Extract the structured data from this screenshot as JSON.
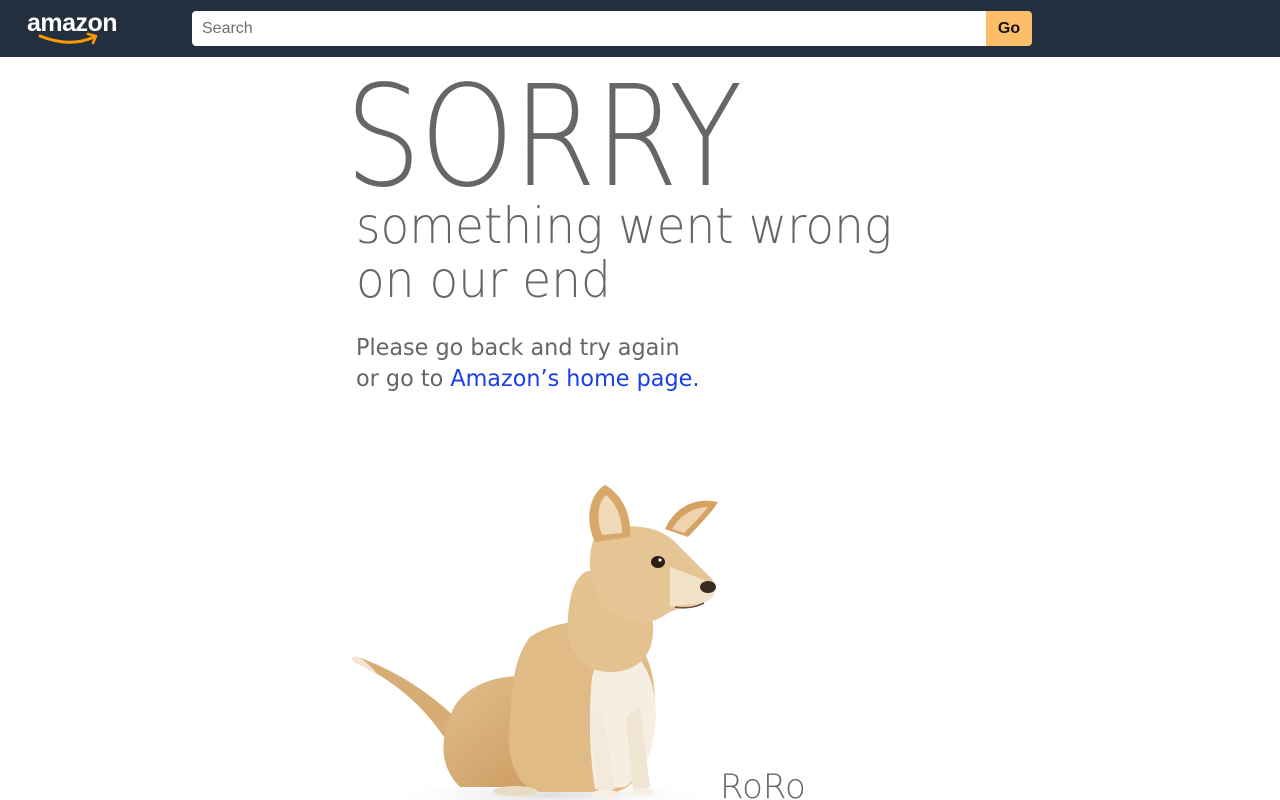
{
  "header": {
    "logo_text": "amazon",
    "logo_icon": "amazon-smile-logo",
    "bg_color": "#232f3e",
    "search": {
      "placeholder": "Search",
      "value": ""
    },
    "go_label": "Go",
    "go_color": "#febd69"
  },
  "error": {
    "heading": "SORRY",
    "subheading_line1": "something went wrong",
    "subheading_line2": "on our end",
    "instruction_line1": "Please go back and try again",
    "instruction_prefix": "or go to ",
    "home_link": "Amazon’s home page.",
    "text_color": "#666666",
    "link_color": "#1a3fe8"
  },
  "dog": {
    "icon": "dog-photo",
    "name": "RoRo"
  }
}
